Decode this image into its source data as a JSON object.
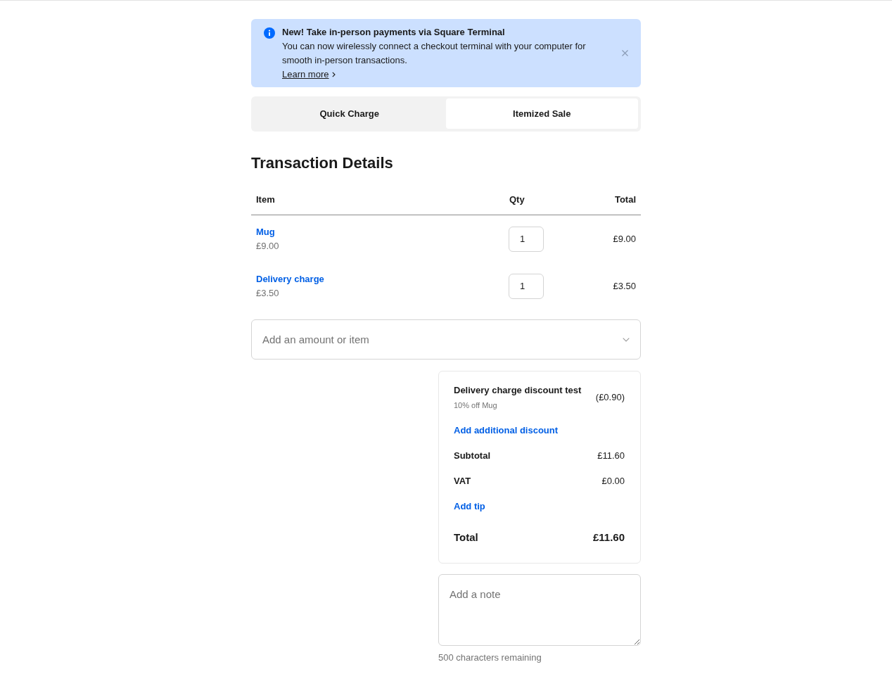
{
  "banner": {
    "title": "New! Take in-person payments via Square Terminal",
    "message": "You can now wirelessly connect a checkout terminal with your computer for smooth in-person transactions.",
    "link": "Learn more"
  },
  "tabs": [
    {
      "label": "Quick Charge",
      "selected": false
    },
    {
      "label": "Itemized Sale",
      "selected": true
    }
  ],
  "heading": "Transaction Details",
  "table": {
    "columns": [
      "Item",
      "Qty",
      "Total"
    ],
    "rows": [
      {
        "name": "Mug",
        "price": "£9.00",
        "qty": "1",
        "total": "£9.00"
      },
      {
        "name": "Delivery charge",
        "price": "£3.50",
        "qty": "1",
        "total": "£3.50"
      }
    ]
  },
  "add_item": {
    "placeholder": "Add an amount or item"
  },
  "summary": [
    {
      "kind": "discount",
      "label": "Delivery charge discount test",
      "detail": "10% off Mug",
      "value": "(£0.90)"
    },
    {
      "kind": "link",
      "label": "Add additional discount"
    },
    {
      "kind": "line",
      "label": "Subtotal",
      "value": "£11.60"
    },
    {
      "kind": "line",
      "label": "VAT",
      "value": "£0.00"
    },
    {
      "kind": "link",
      "label": "Add tip"
    },
    {
      "kind": "total",
      "label": "Total",
      "value": "£11.60"
    }
  ],
  "note": {
    "placeholder": "Add a note",
    "remaining": "500 characters remaining"
  }
}
